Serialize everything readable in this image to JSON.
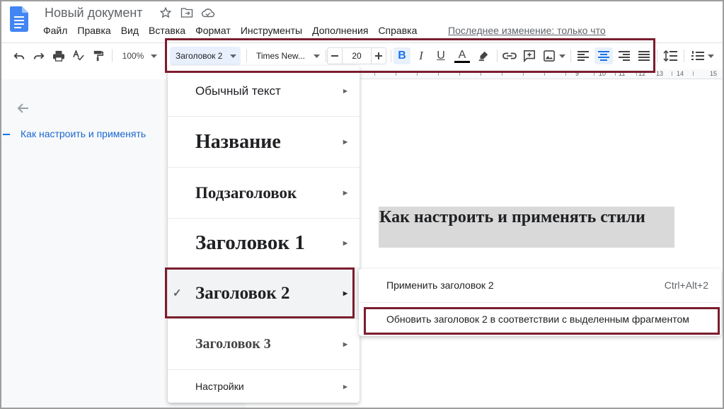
{
  "window": {
    "title": "Новый документ",
    "last_edit": "Последнее изменение: только что"
  },
  "menu": [
    "Файл",
    "Правка",
    "Вид",
    "Вставка",
    "Формат",
    "Инструменты",
    "Дополнения",
    "Справка"
  ],
  "toolbar": {
    "zoom": "100%",
    "style": "Заголовок 2",
    "font": "Times New...",
    "font_size": "20",
    "bold": "B",
    "italic": "I",
    "underline": "U",
    "text_color": "A"
  },
  "ruler": {
    "labels": [
      "9",
      "10",
      "11",
      "12",
      "13",
      "14",
      "15"
    ]
  },
  "outline": {
    "item": "Как настроить и применять"
  },
  "document": {
    "heading": "Как настроить и применять стили"
  },
  "style_menu": {
    "items": [
      {
        "label": "Обычный текст",
        "selected": false
      },
      {
        "label": "Название",
        "selected": false
      },
      {
        "label": "Подзаголовок",
        "selected": false
      },
      {
        "label": "Заголовок 1",
        "selected": false
      },
      {
        "label": "Заголовок 2",
        "selected": true
      },
      {
        "label": "Заголовок 3",
        "selected": false
      },
      {
        "label": "Настройки",
        "selected": false
      }
    ],
    "check": "✓"
  },
  "submenu": {
    "apply": "Применить заголовок 2",
    "apply_shortcut": "Ctrl+Alt+2",
    "update": "Обновить заголовок 2 в соответствии с выделенным фрагментом"
  },
  "colors": {
    "accent": "#1a73e8",
    "highlight_box": "#7b1d2e",
    "heading_bg": "#d9d9d9"
  }
}
